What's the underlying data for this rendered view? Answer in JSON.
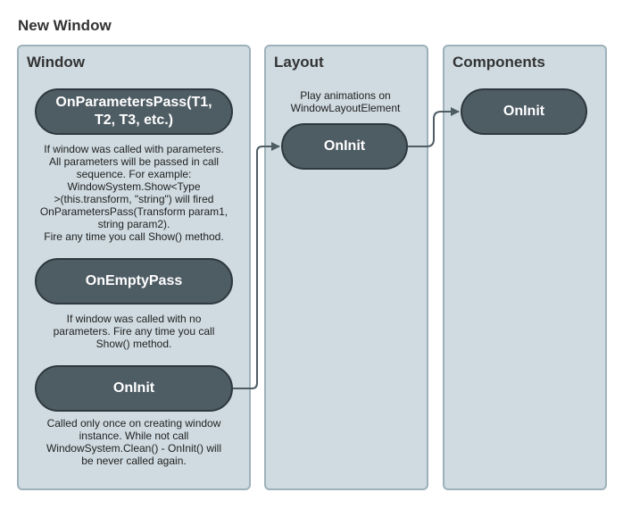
{
  "page": {
    "title": "New Window"
  },
  "lanes": {
    "window": {
      "title": "Window"
    },
    "layout": {
      "title": "Layout"
    },
    "components": {
      "title": "Components"
    }
  },
  "nodes": {
    "on_parameters_pass": "OnParametersPass(T1,\nT2, T3, etc.)",
    "on_empty_pass": "OnEmptyPass",
    "window_on_init": "OnInit",
    "layout_on_init": "OnInit",
    "components_on_init": "OnInit"
  },
  "notes": {
    "on_parameters_pass": "If window was called with parameters.\nAll parameters will be passed in call\nsequence. For example:\nWindowSystem.Show<Type\n>(this.transform, \"string\") will fired\nOnParametersPass(Transform param1,\nstring param2).\nFire any time you call Show() method.",
    "on_empty_pass": "If window was called with no\nparameters. Fire any time you call\nShow() method.",
    "window_on_init": "Called only once on creating window\ninstance. While not call\nWindowSystem.Clean()  - OnInit() will\nbe never called again.",
    "layout_on_init": "Play animations on\nWindowLayoutElement"
  },
  "colors": {
    "lane_fill": "#cfdbe1",
    "lane_border": "#9eb1ba",
    "node_fill": "#4e5c64",
    "node_border": "#2e393f",
    "connector": "#4e5c64"
  }
}
